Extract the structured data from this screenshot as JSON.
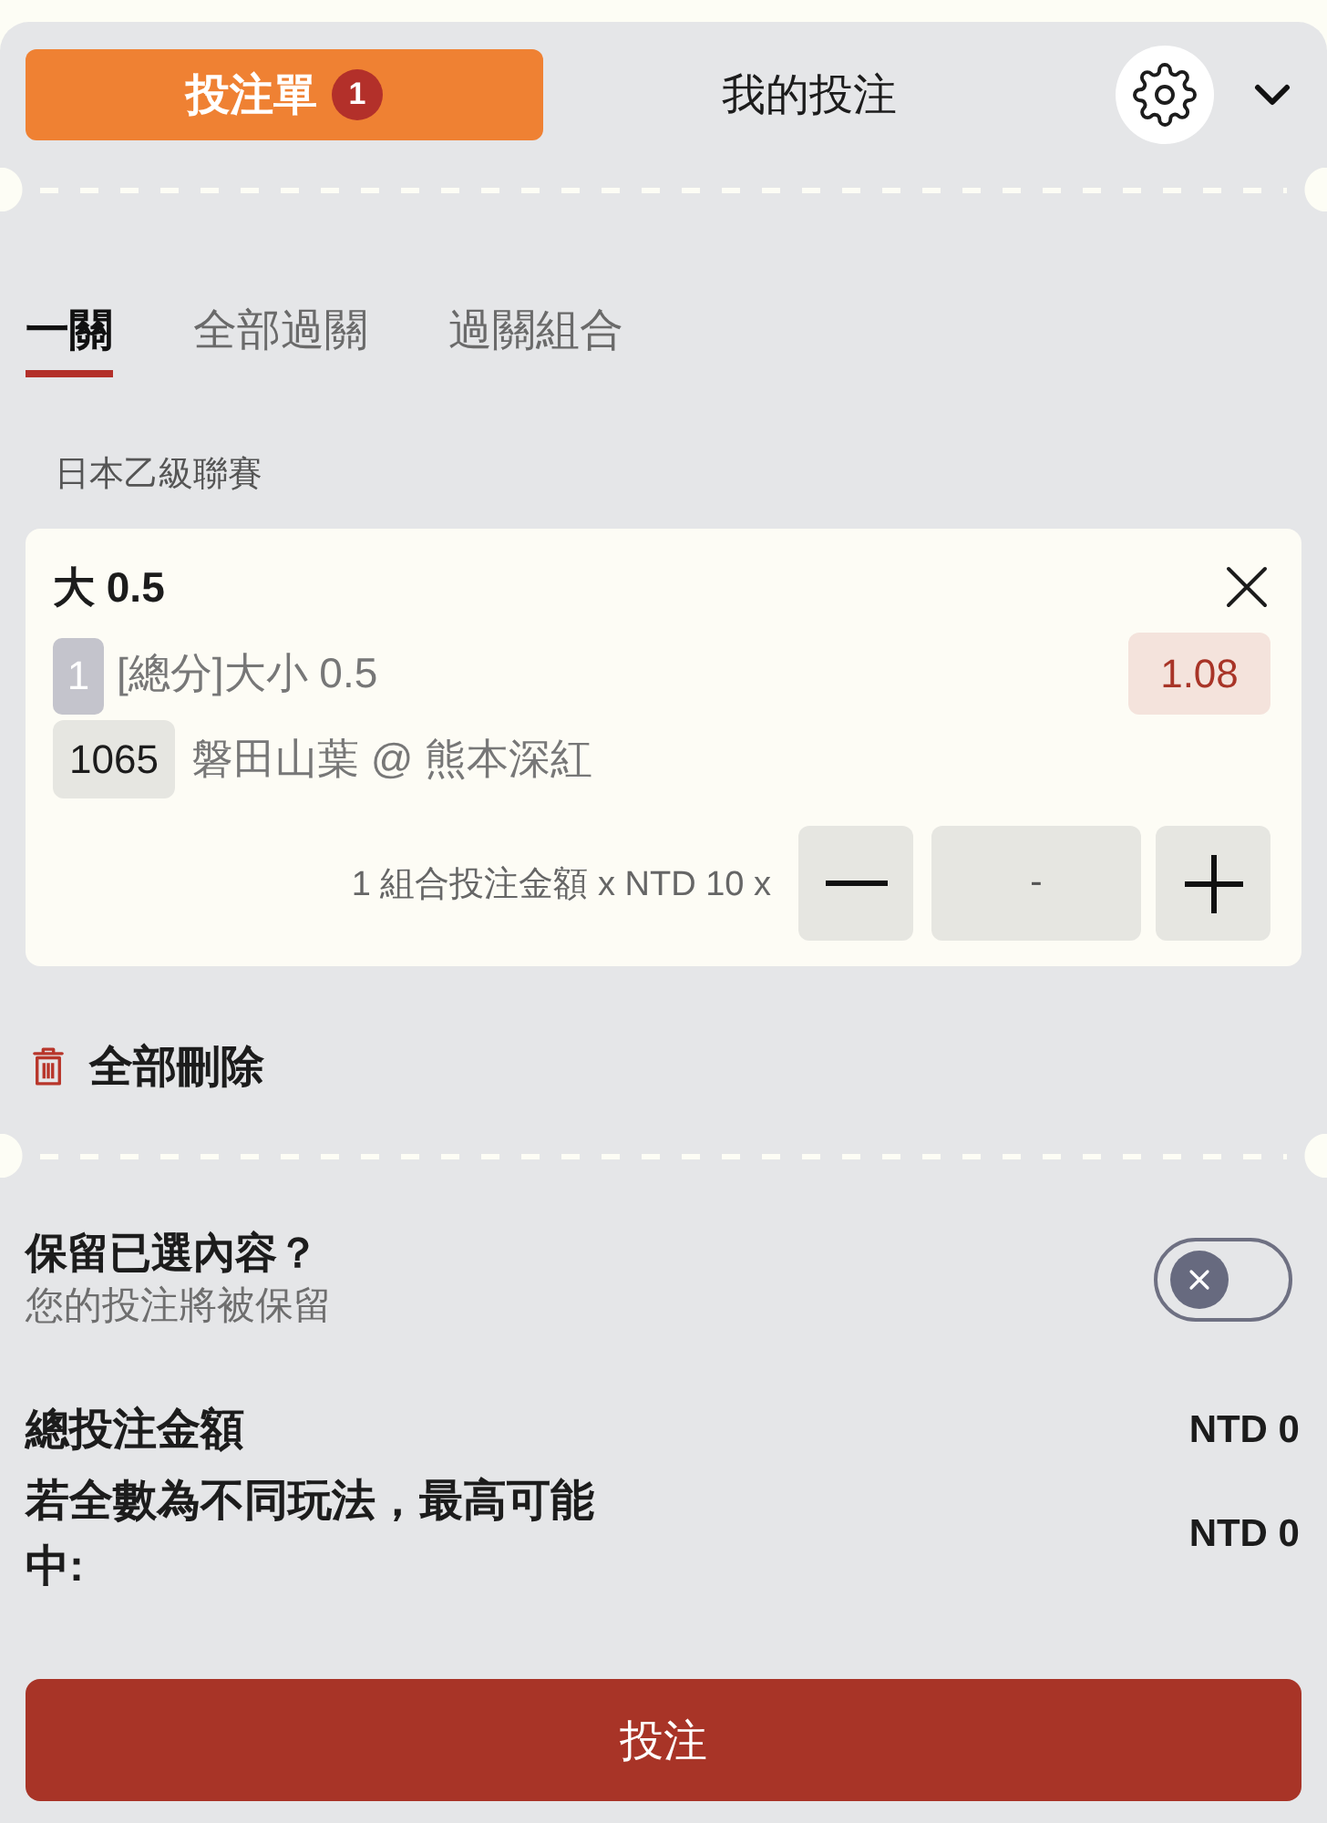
{
  "header": {
    "tabs": [
      {
        "label": "投注單",
        "badge": "1",
        "selected": true
      },
      {
        "label": "我的投注",
        "selected": false
      }
    ]
  },
  "bet_type_tabs": [
    {
      "label": "一關",
      "selected": true
    },
    {
      "label": "全部過關",
      "selected": false
    },
    {
      "label": "過關組合",
      "selected": false
    }
  ],
  "league": "日本乙級聯賽",
  "selection": {
    "title": "大 0.5",
    "leg": "1",
    "market": "[總分]大小 0.5",
    "odds": "1.08",
    "match_code": "1065",
    "match": "磐田山葉 @ 熊本深紅",
    "stake_label": "1 組合投注金額 x NTD 10 x",
    "stake_value": "-"
  },
  "delete_all": "全部刪除",
  "keep_selections": {
    "title": "保留已選內容？",
    "subtitle": "您的投注將被保留",
    "on": false
  },
  "summary": [
    {
      "label": "總投注金額",
      "value": "NTD 0"
    },
    {
      "label": "若全數為不同玩法，最高可能中:",
      "value": "NTD 0"
    }
  ],
  "submit_button": "投注"
}
